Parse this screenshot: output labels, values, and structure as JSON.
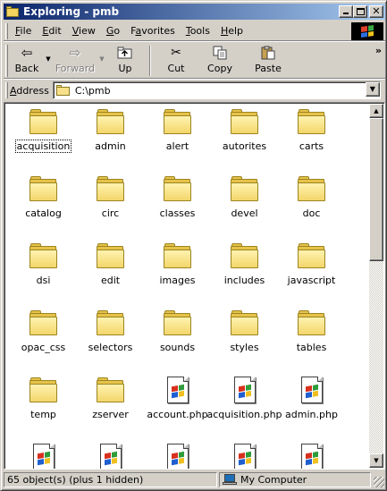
{
  "window": {
    "title": "Exploring - pmb",
    "colors": {
      "titlebar_start": "#0a246a",
      "titlebar_end": "#a6caf0",
      "face": "#d4d0c8"
    },
    "controls": {
      "minimize_icon": "minimize-icon",
      "maximize_icon": "maximize-icon",
      "close_glyph": "✕"
    }
  },
  "menu": {
    "items": [
      {
        "label": "File",
        "accel": "F",
        "rest": "ile"
      },
      {
        "label": "Edit",
        "accel": "E",
        "rest": "dit"
      },
      {
        "label": "View",
        "accel": "V",
        "rest": "iew"
      },
      {
        "label": "Go",
        "accel": "G",
        "rest": "o"
      },
      {
        "label": "Favorites",
        "pre": "F",
        "accel": "a",
        "rest": "vorites"
      },
      {
        "label": "Tools",
        "accel": "T",
        "rest": "ools"
      },
      {
        "label": "Help",
        "accel": "H",
        "rest": "elp"
      }
    ]
  },
  "toolbar": {
    "back": {
      "label": "Back",
      "icon": "back-arrow-icon",
      "glyph": "⇦"
    },
    "forward": {
      "label": "Forward",
      "icon": "forward-arrow-icon",
      "glyph": "⇨",
      "disabled": true
    },
    "up": {
      "label": "Up",
      "icon": "up-folder-icon"
    },
    "cut": {
      "label": "Cut",
      "icon": "scissors-icon",
      "glyph": "✂"
    },
    "copy": {
      "label": "Copy",
      "icon": "copy-icon"
    },
    "paste": {
      "label": "Paste",
      "icon": "paste-icon"
    },
    "more_glyph": "»",
    "drop_glyph": "▼"
  },
  "address": {
    "label": "Address",
    "value": "C:\\pmb",
    "drop_glyph": "▼"
  },
  "files": [
    {
      "name": "acquisition",
      "type": "folder",
      "focused": true
    },
    {
      "name": "admin",
      "type": "folder"
    },
    {
      "name": "alert",
      "type": "folder"
    },
    {
      "name": "autorites",
      "type": "folder"
    },
    {
      "name": "carts",
      "type": "folder"
    },
    {
      "name": "catalog",
      "type": "folder"
    },
    {
      "name": "circ",
      "type": "folder"
    },
    {
      "name": "classes",
      "type": "folder"
    },
    {
      "name": "devel",
      "type": "folder"
    },
    {
      "name": "doc",
      "type": "folder"
    },
    {
      "name": "dsi",
      "type": "folder"
    },
    {
      "name": "edit",
      "type": "folder"
    },
    {
      "name": "images",
      "type": "folder"
    },
    {
      "name": "includes",
      "type": "folder"
    },
    {
      "name": "javascript",
      "type": "folder"
    },
    {
      "name": "opac_css",
      "type": "folder"
    },
    {
      "name": "selectors",
      "type": "folder"
    },
    {
      "name": "sounds",
      "type": "folder"
    },
    {
      "name": "styles",
      "type": "folder"
    },
    {
      "name": "tables",
      "type": "folder"
    },
    {
      "name": "temp",
      "type": "folder"
    },
    {
      "name": "zserver",
      "type": "folder"
    },
    {
      "name": "account.php",
      "type": "php"
    },
    {
      "name": "acquisition.php",
      "type": "php"
    },
    {
      "name": "admin.php",
      "type": "php"
    },
    {
      "name": "",
      "type": "php"
    },
    {
      "name": "",
      "type": "php"
    },
    {
      "name": "",
      "type": "php"
    },
    {
      "name": "",
      "type": "php"
    },
    {
      "name": "",
      "type": "php"
    }
  ],
  "scrollbar": {
    "up_glyph": "▲",
    "down_glyph": "▼"
  },
  "status": {
    "objects": "65 object(s) (plus 1 hidden)",
    "location": "My Computer"
  }
}
